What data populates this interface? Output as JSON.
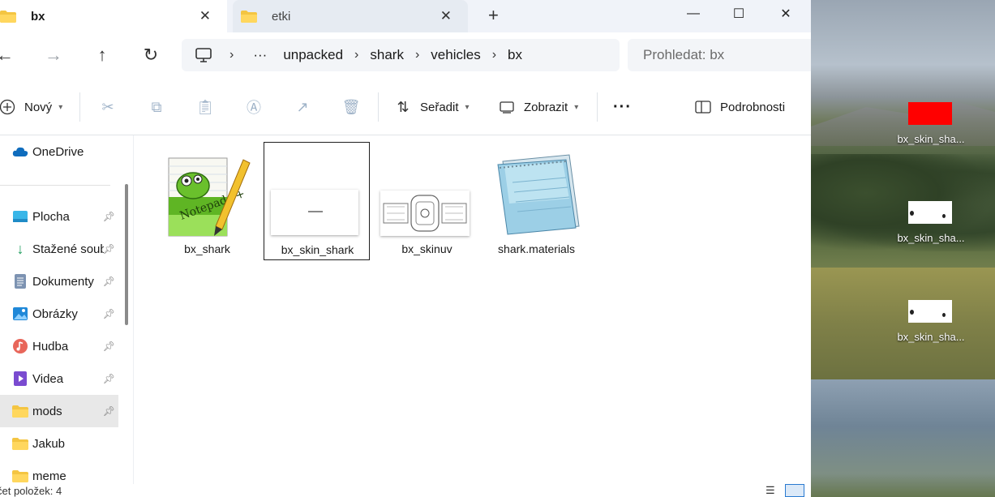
{
  "tabs": [
    {
      "label": "bx",
      "active": true
    },
    {
      "label": "etki",
      "active": false
    }
  ],
  "window_controls": {
    "minimize": "—",
    "maximize": "☐",
    "close": "✕"
  },
  "address": {
    "breadcrumbs": [
      "unpacked",
      "shark",
      "vehicles",
      "bx"
    ],
    "overflow": "···"
  },
  "search": {
    "placeholder": "Prohledat: bx"
  },
  "toolbar": {
    "new_label": "Nový",
    "sort_label": "Seřadit",
    "view_label": "Zobrazit",
    "more_label": "···",
    "details_label": "Podrobnosti"
  },
  "sidebar": {
    "items": [
      {
        "label": "OneDrive",
        "icon": "cloud-icon",
        "pinned": false
      },
      {
        "label": "Plocha",
        "icon": "desktop-icon",
        "pinned": true
      },
      {
        "label": "Stažené soubory",
        "icon": "download-icon",
        "pinned": true
      },
      {
        "label": "Dokumenty",
        "icon": "document-icon",
        "pinned": true
      },
      {
        "label": "Obrázky",
        "icon": "pictures-icon",
        "pinned": true
      },
      {
        "label": "Hudba",
        "icon": "music-icon",
        "pinned": true
      },
      {
        "label": "Videa",
        "icon": "video-icon",
        "pinned": true
      },
      {
        "label": "mods",
        "icon": "folder-icon",
        "pinned": true,
        "selected": true
      },
      {
        "label": "Jakub",
        "icon": "folder-icon",
        "pinned": false
      },
      {
        "label": "meme",
        "icon": "folder-icon",
        "pinned": false
      }
    ]
  },
  "files": [
    {
      "name": "bx_shark",
      "type": "notepad-plus-plus-file"
    },
    {
      "name": "bx_skin_shark",
      "type": "image-file",
      "selected": true
    },
    {
      "name": "bx_skinuv",
      "type": "image-file"
    },
    {
      "name": "shark.materials",
      "type": "notepad-file"
    }
  ],
  "status": {
    "item_count": "čet položek: 4"
  },
  "desktop_icons": [
    {
      "label": "bx_skin_sha..."
    },
    {
      "label": "bx_skin_sha..."
    },
    {
      "label": "bx_skin_sha..."
    }
  ],
  "colors": {
    "accent": "#0067c0",
    "folder": "#f4c542",
    "selection": "#e8e8e8"
  }
}
